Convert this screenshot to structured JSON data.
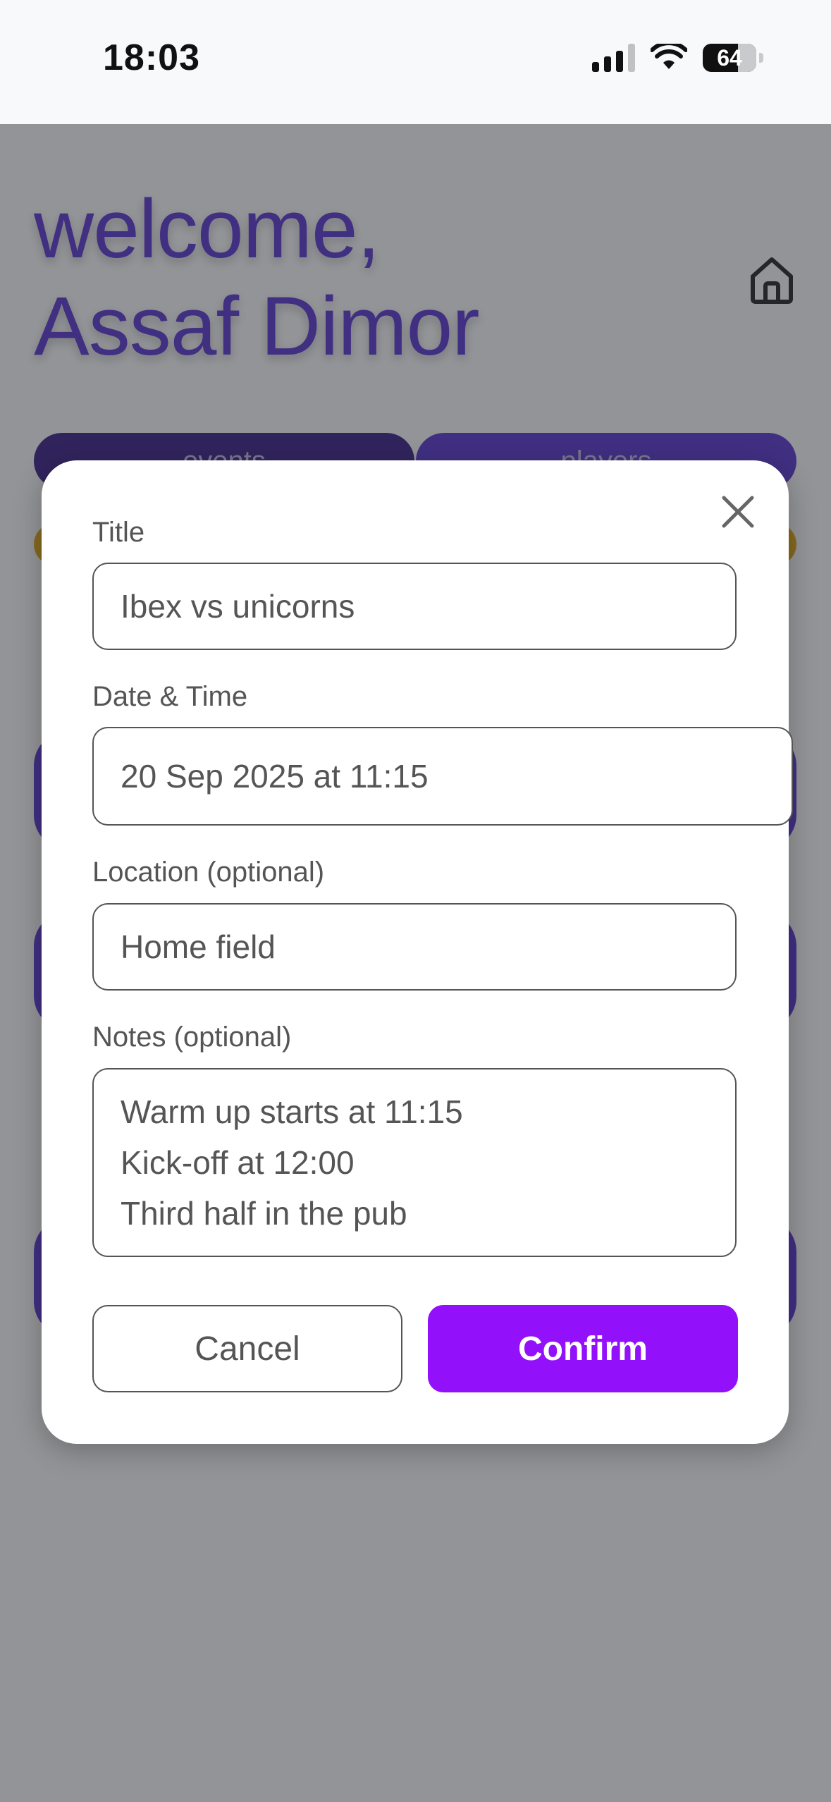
{
  "status_bar": {
    "time": "18:03",
    "battery": "64"
  },
  "app": {
    "greeting_line1": "welcome,",
    "greeting_line2": "Assaf Dimor",
    "tabs": [
      {
        "label": "events"
      },
      {
        "label": "players"
      }
    ]
  },
  "modal": {
    "title_label": "Title",
    "title_value": "Ibex vs unicorns",
    "datetime_label": "Date & Time",
    "datetime_value": "20 Sep 2025 at 11:15",
    "location_label": "Location (optional)",
    "location_value": "Home field",
    "notes_label": "Notes (optional)",
    "notes_lines": [
      "Warm up starts at 11:15",
      "Kick-off at 12:00",
      "Third half in the pub"
    ],
    "cancel_label": "Cancel",
    "confirm_label": "Confirm"
  },
  "colors": {
    "accent": "#5b35d5",
    "confirm": "#9210fa",
    "pill": "#e3a90f"
  }
}
